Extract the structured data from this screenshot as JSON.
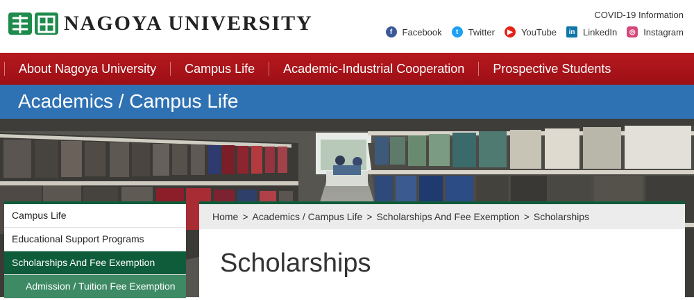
{
  "header": {
    "university_name": "NAGOYA UNIVERSITY",
    "covid_link": "COVID-19 Information",
    "social": [
      {
        "label": "Facebook",
        "icon": "facebook-icon",
        "color": "#3b5998"
      },
      {
        "label": "Twitter",
        "icon": "twitter-icon",
        "color": "#1da1f2"
      },
      {
        "label": "YouTube",
        "icon": "youtube-icon",
        "color": "#e62117"
      },
      {
        "label": "LinkedIn",
        "icon": "linkedin-icon",
        "color": "#0e76a8"
      },
      {
        "label": "Instagram",
        "icon": "instagram-icon",
        "color": "#d6487b"
      }
    ]
  },
  "nav": {
    "items": [
      "About Nagoya University",
      "Campus Life",
      "Academic-Industrial Cooperation",
      "Prospective Students"
    ]
  },
  "band": {
    "title": "Academics / Campus Life"
  },
  "sidebar": {
    "items": [
      "Campus Life",
      "Educational Support Programs",
      "Scholarships And Fee Exemption",
      "Admission / Tuition Fee Exemption"
    ]
  },
  "breadcrumb": {
    "home": "Home",
    "level1": "Academics / Campus Life",
    "level2": "Scholarships And Fee Exemption",
    "current": "Scholarships"
  },
  "main": {
    "title": "Scholarships"
  },
  "colors": {
    "nav_red": "#a8141a",
    "band_blue": "#2f72b3",
    "accent_green": "#0f5c3a"
  }
}
